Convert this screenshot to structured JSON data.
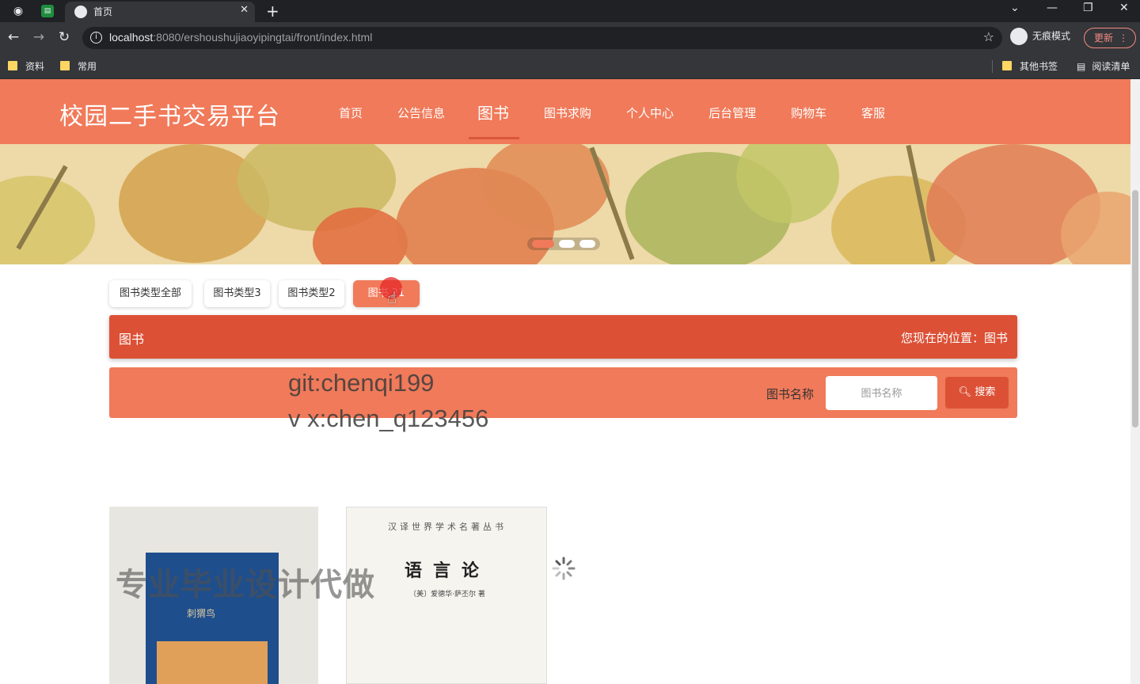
{
  "browser": {
    "tab_title": "首页",
    "url_host": "localhost",
    "url_rest": ":8080/ershoushujiaoyipingtai/front/index.html",
    "incognito_label": "无痕模式",
    "update_label": "更新",
    "bookmarks": [
      "资料",
      "常用",
      "其他书签",
      "阅读清单"
    ]
  },
  "site": {
    "logo": "校园二手书交易平台",
    "nav": [
      "首页",
      "公告信息",
      "图书",
      "图书求购",
      "个人中心",
      "后台管理",
      "购物车",
      "客服"
    ],
    "active_nav": "图书"
  },
  "categories": [
    "图书类型全部",
    "图书类型3",
    "图书类型2",
    "图书类型1"
  ],
  "category_visible_labels": [
    "图书类型全部",
    "图书类型3",
    "图书类型2",
    "图书    21"
  ],
  "titlebar": {
    "title": "图书",
    "location": "您现在的位置：图书"
  },
  "search": {
    "label": "图书名称",
    "placeholder": "图书名称",
    "button": "搜索"
  },
  "watermarks": {
    "line1": "git:chenqi199",
    "line2": "v x:chen_q123456",
    "big": "专业毕业设计代做"
  },
  "books": [
    {
      "cover_text": "刺猬鸟"
    },
    {
      "series": "汉译世界学术名著丛书",
      "title": "语言论",
      "author": "〔美〕爱德华·萨丕尔 著"
    }
  ],
  "colors": {
    "primary": "#f07a5a",
    "primary_dark": "#dc5136"
  }
}
